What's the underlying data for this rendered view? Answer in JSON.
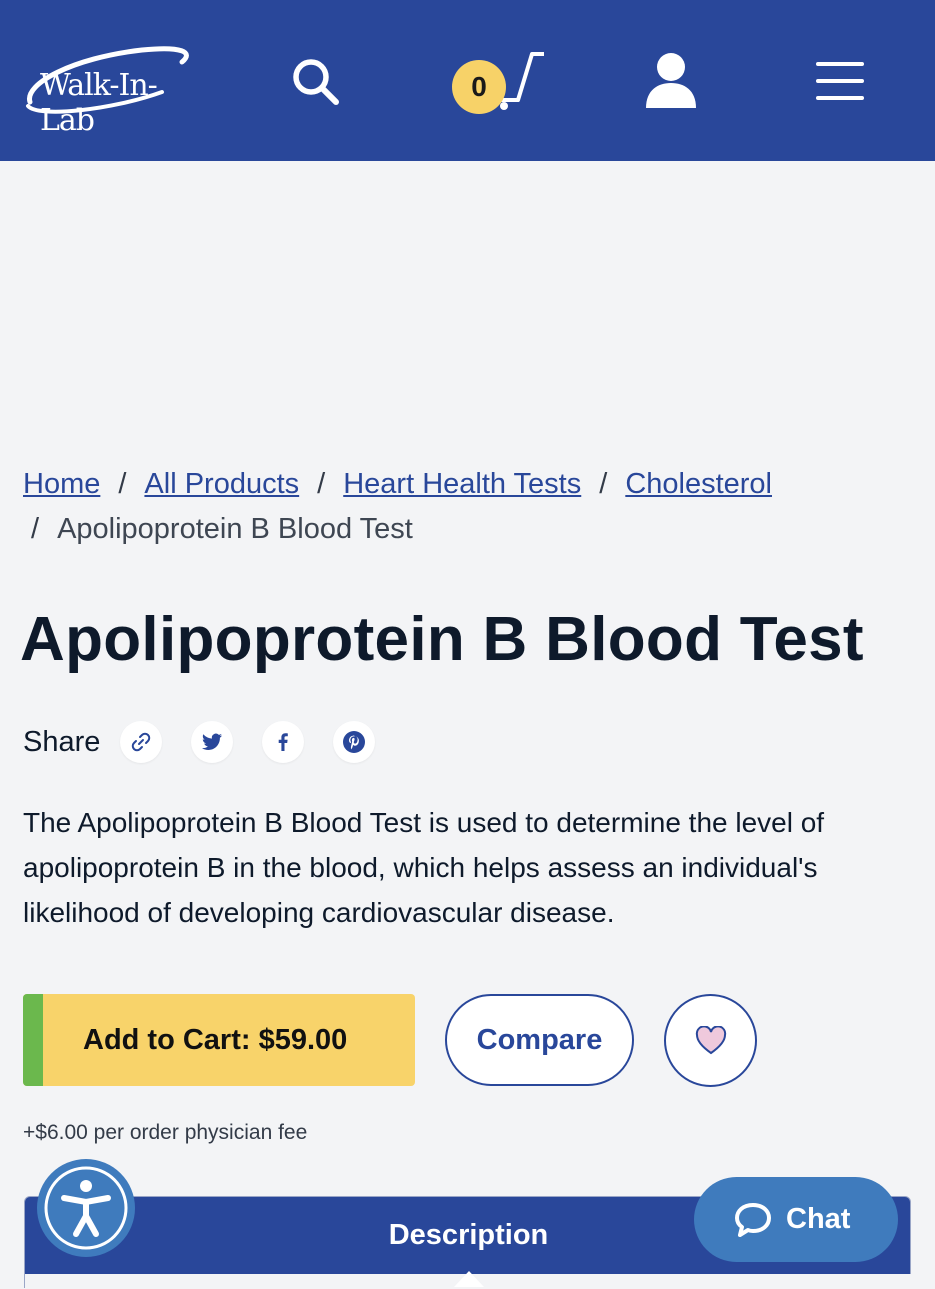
{
  "header": {
    "logo_text": "Walk-In-Lab",
    "cart_count": "0",
    "icons": [
      "search-icon",
      "cart-icon",
      "user-icon",
      "menu-icon"
    ],
    "background_color": "#29479a"
  },
  "breadcrumb": {
    "links": [
      "Home",
      "All Products",
      "Heart Health Tests",
      "Cholesterol"
    ],
    "current": "Apolipoprotein B Blood Test",
    "separator": "/"
  },
  "product": {
    "title": "Apolipoprotein B Blood Test",
    "share_label": "Share",
    "share_icons": [
      "link-icon",
      "twitter-icon",
      "facebook-icon",
      "pinterest-icon"
    ],
    "description": "The Apolipoprotein B Blood Test is used to determine the level of apolipoprotein B in the blood, which helps assess an individual's likelihood of developing cardiovascular disease.",
    "add_to_cart_label": "Add to Cart: $59.00",
    "compare_label": "Compare",
    "fee_note": "+$6.00 per order physician fee"
  },
  "tabs": {
    "active": "Description"
  },
  "widgets": {
    "chat_label": "Chat",
    "accessibility_icon": "accessibility-icon",
    "accent_color": "#3f7bbd",
    "cart_button_color": "#f8d36a"
  }
}
